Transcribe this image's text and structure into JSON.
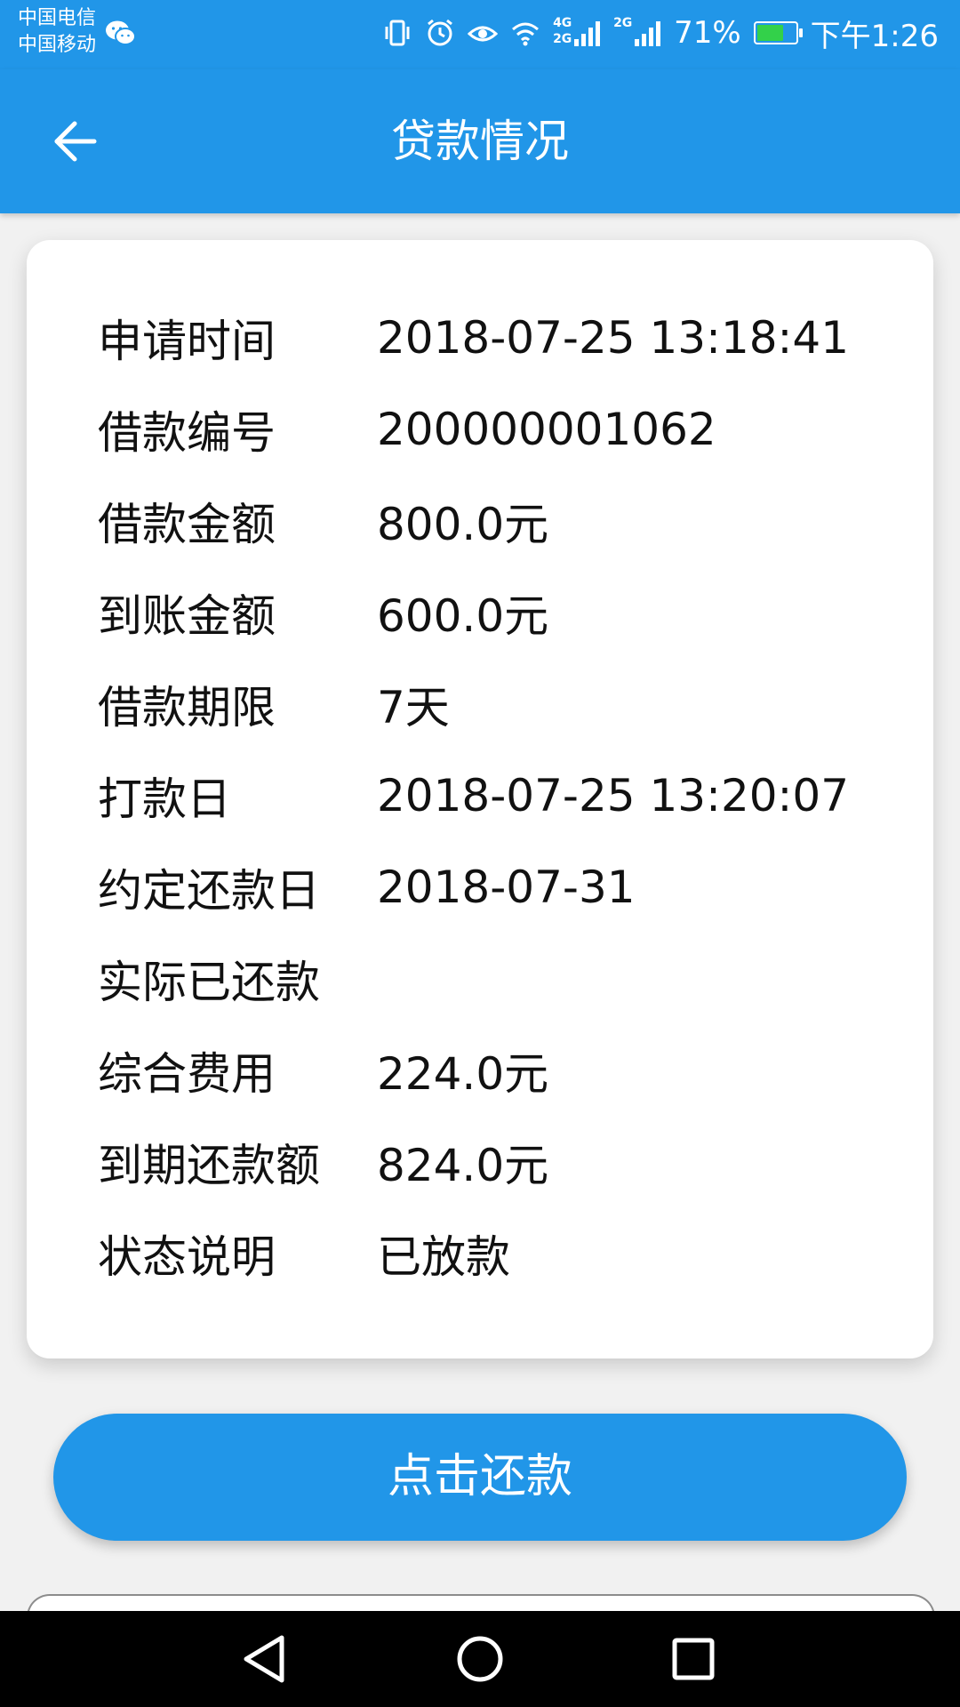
{
  "status_bar": {
    "carrier_1": "中国电信",
    "carrier_2": "中国移动",
    "network_1": "4G",
    "network_2": "2G",
    "network_3": "2G",
    "battery_percent": "71%",
    "battery_level": 0.71,
    "battery_color": "#33d14a",
    "time": "下午1:26",
    "icons": [
      "wechat-icon",
      "vibrate-icon",
      "alarm-icon",
      "eye-icon",
      "wifi-icon",
      "signal-icon",
      "signal-icon",
      "battery-icon"
    ]
  },
  "app_bar": {
    "title": "贷款情况",
    "back_icon": "arrow-left-icon",
    "color": "#2196e8"
  },
  "loan_details": {
    "rows": [
      {
        "label": "申请时间",
        "value": "2018-07-25 13:18:41"
      },
      {
        "label": "借款编号",
        "value": "200000001062"
      },
      {
        "label": "借款金额",
        "value": "800.0元"
      },
      {
        "label": "到账金额",
        "value": "600.0元"
      },
      {
        "label": "借款期限",
        "value": "7天"
      },
      {
        "label": "打款日",
        "value": "2018-07-25 13:20:07"
      },
      {
        "label": "约定还款日",
        "value": "2018-07-31"
      },
      {
        "label": "实际已还款",
        "value": ""
      },
      {
        "label": "综合费用",
        "value": "224.0元"
      },
      {
        "label": "到期还款额",
        "value": "824.0元"
      },
      {
        "label": "状态说明",
        "value": "已放款"
      }
    ]
  },
  "actions": {
    "repay_label": "点击还款"
  },
  "nav_bar": {
    "icons": [
      "back-triangle-icon",
      "home-circle-icon",
      "recents-square-icon"
    ]
  }
}
